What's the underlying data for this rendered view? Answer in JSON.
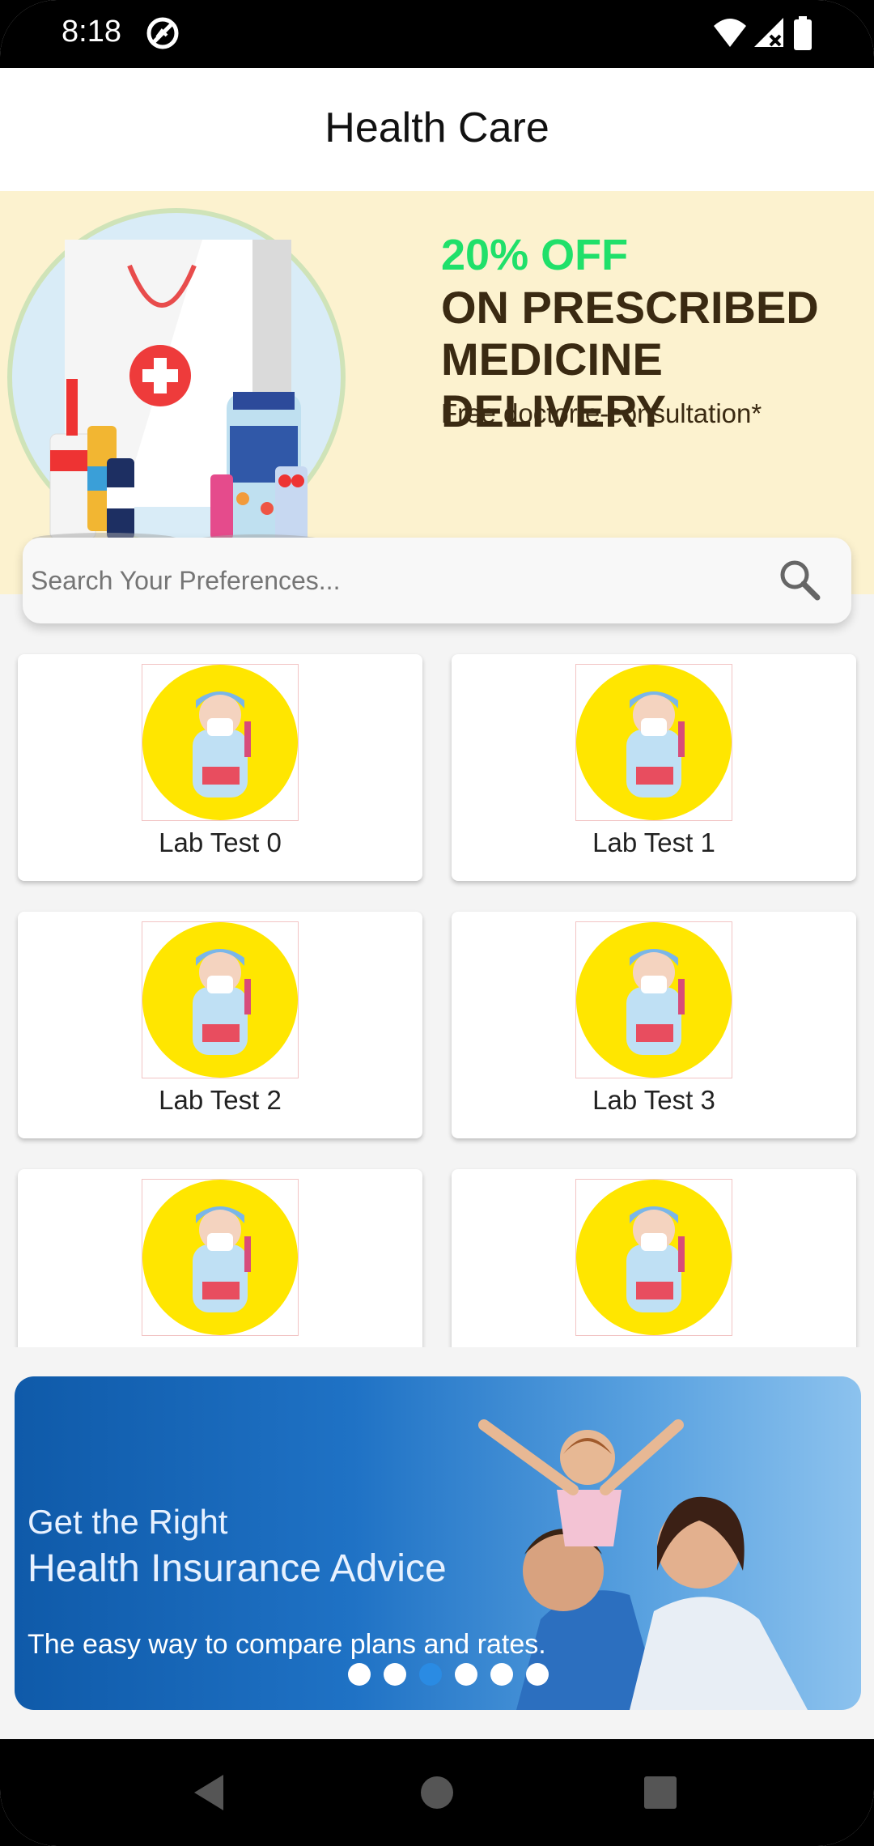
{
  "status_bar": {
    "time": "8:18"
  },
  "app_bar": {
    "title": "Health Care"
  },
  "promo": {
    "discount": "20% OFF",
    "headline_1": "ON PRESCRIBED",
    "headline_2": "MEDICINE DELIVERY",
    "subtext": "Free doctor e-consultation*"
  },
  "search": {
    "placeholder": "Search Your Preferences..."
  },
  "lab_tests": [
    {
      "label": "Lab Test  0"
    },
    {
      "label": "Lab Test  1"
    },
    {
      "label": "Lab Test  2"
    },
    {
      "label": "Lab Test  3"
    },
    {
      "label": ""
    },
    {
      "label": ""
    }
  ],
  "insurance_banner": {
    "line_1": "Get the Right",
    "line_2": "Health Insurance Advice",
    "line_3": "The easy way to compare plans and rates.",
    "slide_count": 6,
    "active_slide": 3
  },
  "colors": {
    "promo_bg": "#fcf2cf",
    "discount_green": "#20e06a",
    "active_dot": "#2a8be3",
    "inactive_dot": "#ffffff",
    "lab_circle": "#ffe600"
  }
}
